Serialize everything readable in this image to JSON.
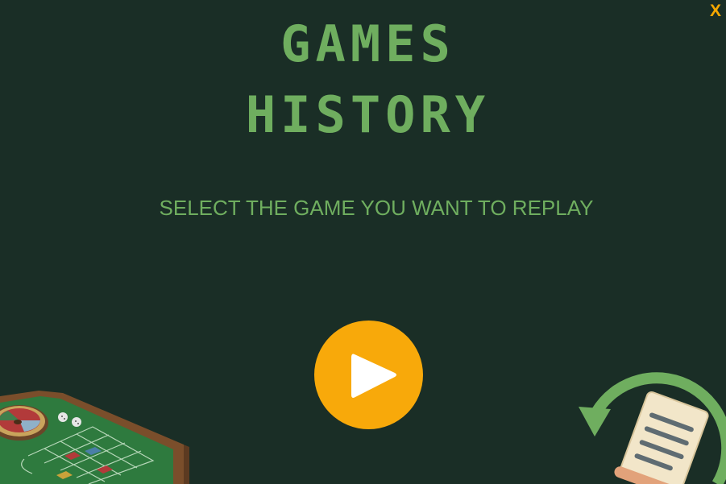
{
  "header": {
    "title_line1": "GAMES",
    "title_line2": "HISTORY",
    "subtitle": "SELECT THE GAME YOU WANT TO REPLAY",
    "close_label": "X"
  },
  "actions": {
    "play_icon": "play-icon"
  },
  "colors": {
    "background": "#1a2e26",
    "title": "#6fae5f",
    "accent": "#f8a90a",
    "close": "#f6a800"
  }
}
